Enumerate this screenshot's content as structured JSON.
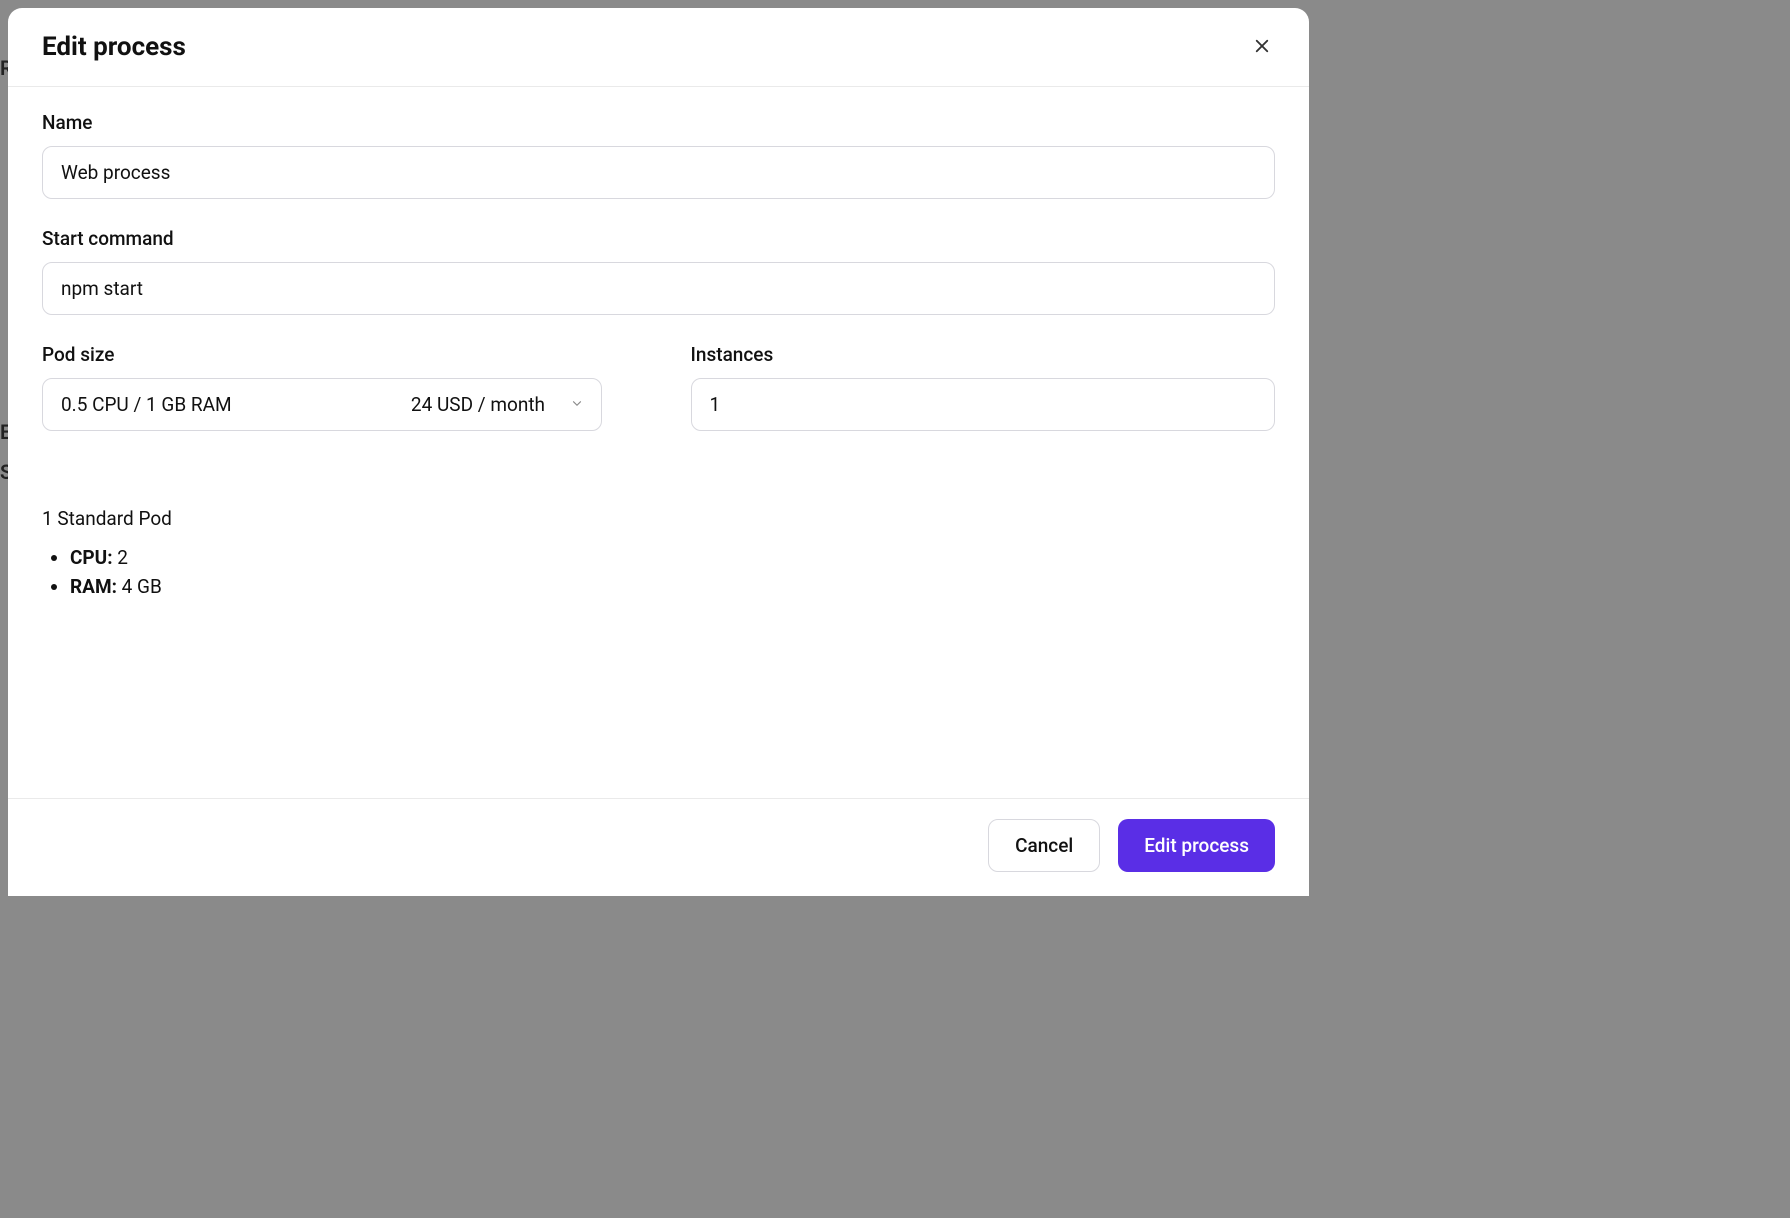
{
  "modal": {
    "title": "Edit process",
    "fields": {
      "name": {
        "label": "Name",
        "value": "Web process"
      },
      "start_command": {
        "label": "Start command",
        "value": "npm start"
      },
      "pod_size": {
        "label": "Pod size",
        "selected_spec": "0.5 CPU / 1 GB RAM",
        "selected_price": "24 USD / month"
      },
      "instances": {
        "label": "Instances",
        "value": "1"
      }
    },
    "summary": {
      "title": "1 Standard Pod",
      "items": [
        {
          "label": "CPU:",
          "value": " 2"
        },
        {
          "label": "RAM:",
          "value": " 4 GB"
        }
      ]
    },
    "footer": {
      "cancel_label": "Cancel",
      "submit_label": "Edit process"
    }
  },
  "background_hints": {
    "r": "R",
    "e": "E",
    "s": "S"
  }
}
